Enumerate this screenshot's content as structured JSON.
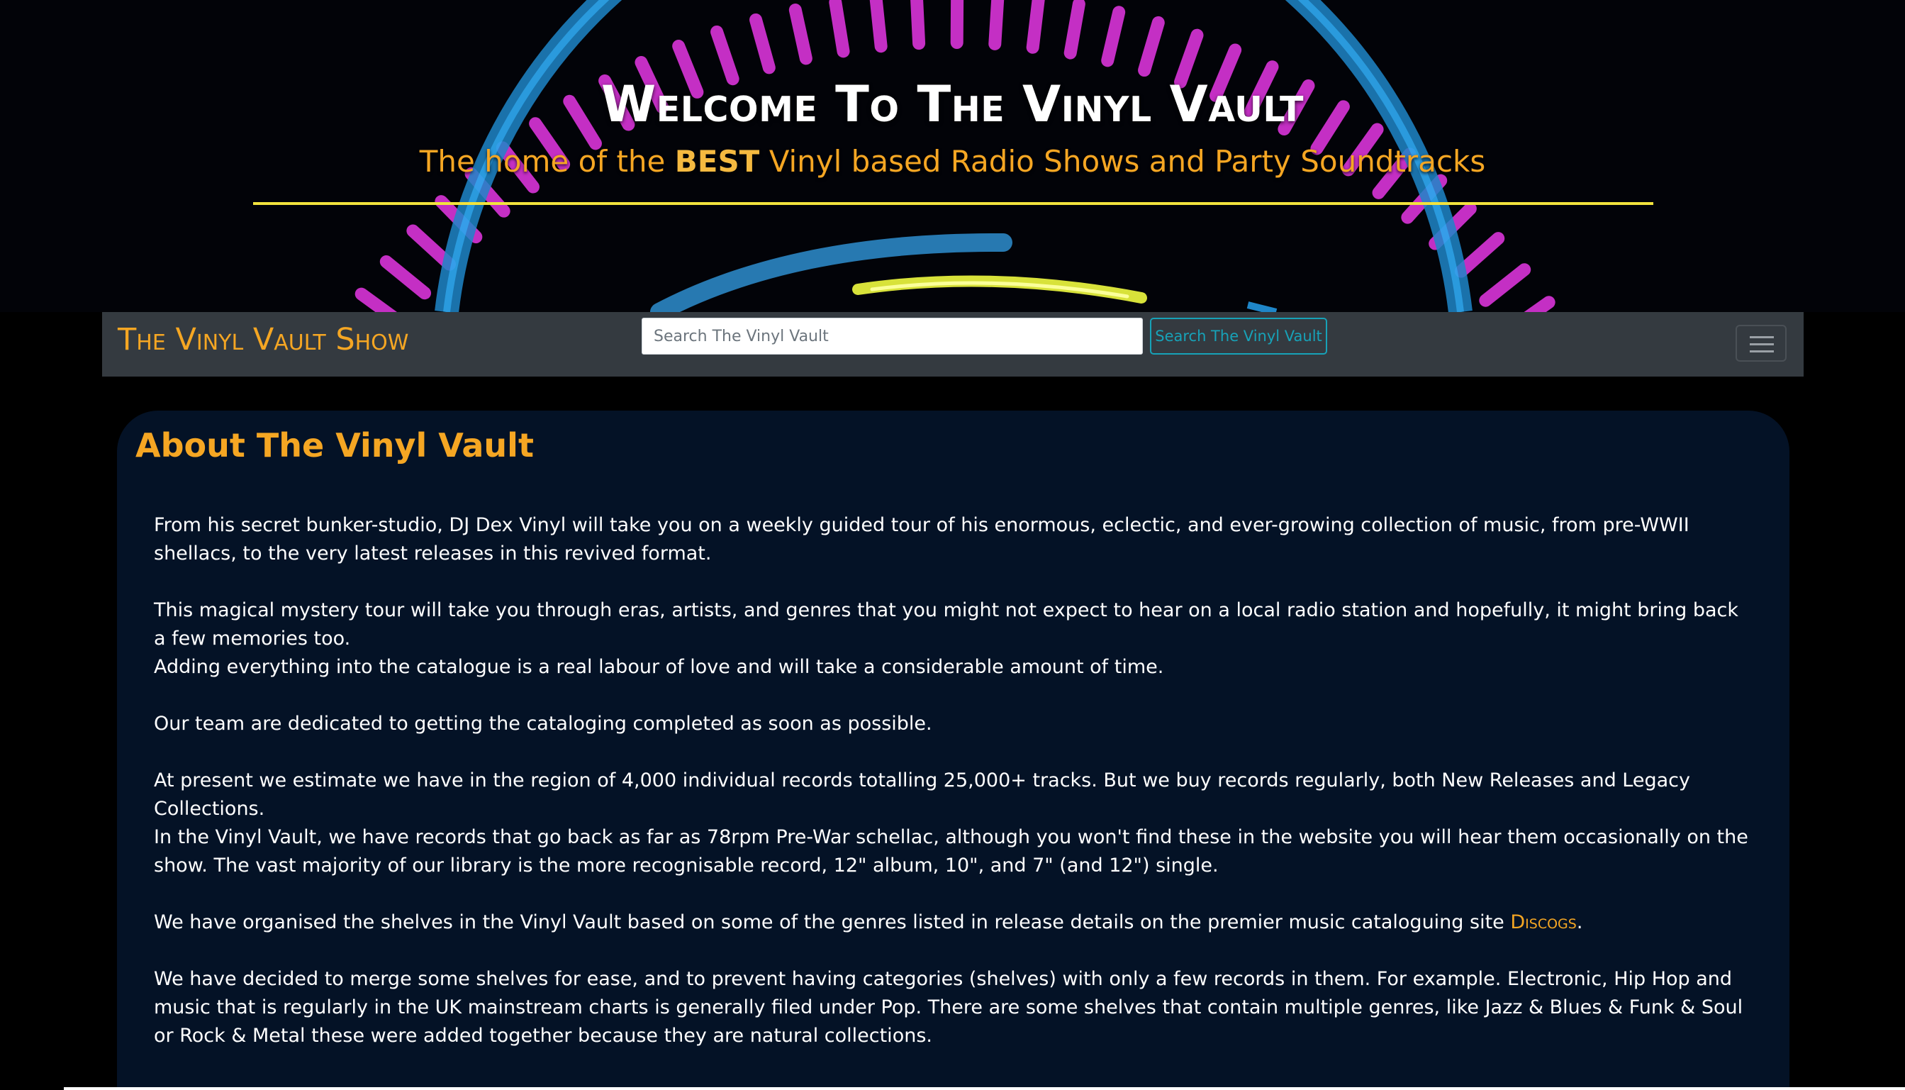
{
  "hero": {
    "title": "Welcome To The Vinyl Vault",
    "subtitle_pre": "The home of the ",
    "subtitle_bold": "BEST",
    "subtitle_post": " Vinyl based Radio Shows and Party Soundtracks"
  },
  "navbar": {
    "brand": "The Vinyl Vault Show",
    "search_placeholder": "Search The Vinyl Vault",
    "search_button": "Search The Vinyl Vault"
  },
  "about": {
    "title": "About The Vinyl Vault",
    "paragraphs": [
      "From his secret bunker-studio, DJ Dex Vinyl will take you on a weekly guided tour of his enormous, eclectic, and ever-growing collection of music, from pre-WWII shellacs, to the very latest releases in this revived format.",
      "This magical mystery tour will take you through eras, artists, and genres that you might not expect to hear on a local radio station and hopefully, it might bring back a few memories too.",
      "Adding everything into the catalogue is a real labour of love and will take a considerable amount of time.",
      "Our team are dedicated to getting the cataloging completed as soon as possible.",
      "At present we estimate we have in the region of 4,000 individual records totalling 25,000+ tracks. But we buy records regularly, both New Releases and Legacy Collections.",
      "In the Vinyl Vault, we have records that go back as far as 78rpm Pre-War schellac, although you won't find these in the website you will hear them occasionally on the show. The vast majority of our library is the more recognisable record, 12\" album, 10\", and 7\" (and 12\") single.",
      "We have organised the shelves in the Vinyl Vault based on some of the genres listed in release details on the premier music cataloguing site ",
      "We have decided to merge some shelves for ease, and to prevent having categories (shelves) with only a few records in them. For example. Electronic, Hip Hop and music that is regularly in the UK mainstream charts is generally filed under Pop. There are some shelves that contain multiple genres, like Jazz & Blues & Funk & Soul or Rock & Metal these were added together because they are natural collections."
    ],
    "discogs_link": "Discogs",
    "period": "."
  },
  "colors": {
    "accent": "#f5a623",
    "navbar_bg": "#343a40",
    "card_bg": "#041226",
    "button_outline": "#17a2b8",
    "rule": "#f2e33d"
  },
  "icons": {
    "menu": "hamburger-menu-icon"
  }
}
